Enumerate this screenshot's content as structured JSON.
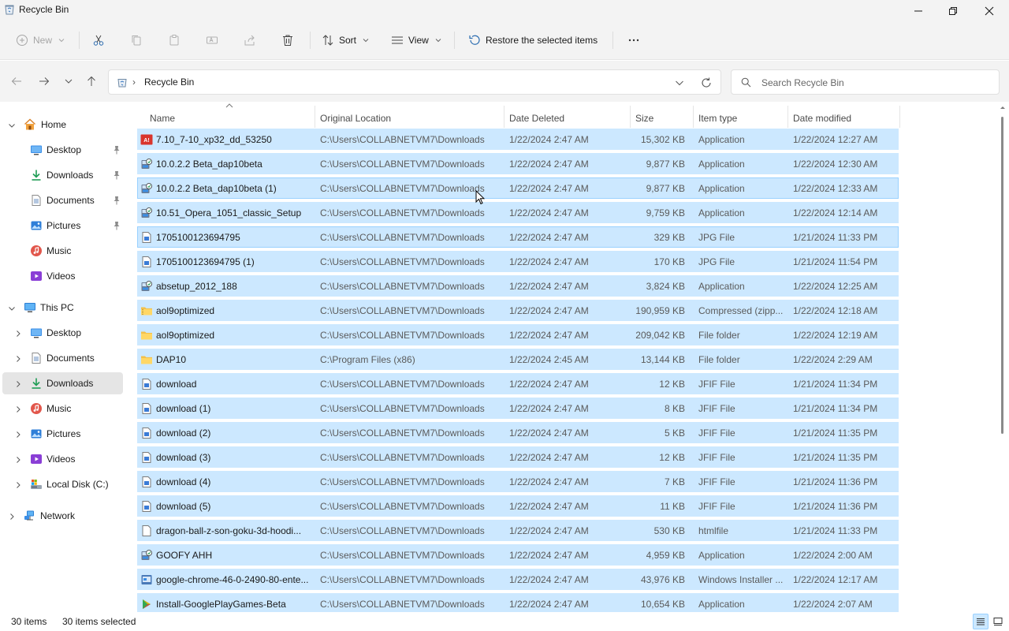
{
  "window": {
    "title": "Recycle Bin"
  },
  "commandbar": {
    "new_label": "New",
    "sort_label": "Sort",
    "view_label": "View",
    "restore_label": "Restore the selected items"
  },
  "address": {
    "crumb": "Recycle Bin",
    "search_placeholder": "Search Recycle Bin"
  },
  "sidebar": {
    "home": "Home",
    "quick": [
      {
        "label": "Desktop",
        "icon": "desktop-icon"
      },
      {
        "label": "Downloads",
        "icon": "download-icon"
      },
      {
        "label": "Documents",
        "icon": "document-icon"
      },
      {
        "label": "Pictures",
        "icon": "picture-icon"
      },
      {
        "label": "Music",
        "icon": "music-icon"
      },
      {
        "label": "Videos",
        "icon": "video-icon"
      }
    ],
    "this_pc": "This PC",
    "pc_items": [
      {
        "label": "Desktop",
        "icon": "desktop-icon"
      },
      {
        "label": "Documents",
        "icon": "document-icon"
      },
      {
        "label": "Downloads",
        "icon": "download-icon"
      },
      {
        "label": "Music",
        "icon": "music-icon"
      },
      {
        "label": "Pictures",
        "icon": "picture-icon"
      },
      {
        "label": "Videos",
        "icon": "video-icon"
      },
      {
        "label": "Local Disk (C:)",
        "icon": "drive-icon"
      }
    ],
    "network": "Network"
  },
  "columns": {
    "name": "Name",
    "location": "Original Location",
    "deleted": "Date Deleted",
    "size": "Size",
    "type": "Item type",
    "modified": "Date modified"
  },
  "files": [
    {
      "name": "7.10_7-10_xp32_dd_53250",
      "loc": "C:\\Users\\COLLABNETVM7\\Downloads",
      "deleted": "1/22/2024 2:47 AM",
      "size": "15,302 KB",
      "type": "Application",
      "modified": "1/22/2024 12:27 AM",
      "icon": "red-app-icon"
    },
    {
      "name": "10.0.2.2 Beta_dap10beta",
      "loc": "C:\\Users\\COLLABNETVM7\\Downloads",
      "deleted": "1/22/2024 2:47 AM",
      "size": "9,877 KB",
      "type": "Application",
      "modified": "1/22/2024 12:30 AM",
      "icon": "installer-icon"
    },
    {
      "name": "10.0.2.2 Beta_dap10beta (1)",
      "loc": "C:\\Users\\COLLABNETVM7\\Downloads",
      "deleted": "1/22/2024 2:47 AM",
      "size": "9,877 KB",
      "type": "Application",
      "modified": "1/22/2024 12:33 AM",
      "icon": "installer-icon"
    },
    {
      "name": "10.51_Opera_1051_classic_Setup",
      "loc": "C:\\Users\\COLLABNETVM7\\Downloads",
      "deleted": "1/22/2024 2:47 AM",
      "size": "9,759 KB",
      "type": "Application",
      "modified": "1/22/2024 12:14 AM",
      "icon": "installer-icon"
    },
    {
      "name": "1705100123694795",
      "loc": "C:\\Users\\COLLABNETVM7\\Downloads",
      "deleted": "1/22/2024 2:47 AM",
      "size": "329 KB",
      "type": "JPG File",
      "modified": "1/21/2024 11:33 PM",
      "icon": "image-file-icon"
    },
    {
      "name": "1705100123694795 (1)",
      "loc": "C:\\Users\\COLLABNETVM7\\Downloads",
      "deleted": "1/22/2024 2:47 AM",
      "size": "170 KB",
      "type": "JPG File",
      "modified": "1/21/2024 11:54 PM",
      "icon": "image-file-icon"
    },
    {
      "name": "absetup_2012_188",
      "loc": "C:\\Users\\COLLABNETVM7\\Downloads",
      "deleted": "1/22/2024 2:47 AM",
      "size": "3,824 KB",
      "type": "Application",
      "modified": "1/22/2024 12:25 AM",
      "icon": "installer-icon"
    },
    {
      "name": "aol9optimized",
      "loc": "C:\\Users\\COLLABNETVM7\\Downloads",
      "deleted": "1/22/2024 2:47 AM",
      "size": "190,959 KB",
      "type": "Compressed (zipp...",
      "modified": "1/22/2024 12:18 AM",
      "icon": "zip-folder-icon"
    },
    {
      "name": "aol9optimized",
      "loc": "C:\\Users\\COLLABNETVM7\\Downloads",
      "deleted": "1/22/2024 2:47 AM",
      "size": "209,042 KB",
      "type": "File folder",
      "modified": "1/22/2024 12:19 AM",
      "icon": "folder-icon"
    },
    {
      "name": "DAP10",
      "loc": "C:\\Program Files (x86)",
      "deleted": "1/22/2024 2:45 AM",
      "size": "13,144 KB",
      "type": "File folder",
      "modified": "1/22/2024 2:29 AM",
      "icon": "folder-icon"
    },
    {
      "name": "download",
      "loc": "C:\\Users\\COLLABNETVM7\\Downloads",
      "deleted": "1/22/2024 2:47 AM",
      "size": "12 KB",
      "type": "JFIF File",
      "modified": "1/21/2024 11:34 PM",
      "icon": "image-file-icon"
    },
    {
      "name": "download (1)",
      "loc": "C:\\Users\\COLLABNETVM7\\Downloads",
      "deleted": "1/22/2024 2:47 AM",
      "size": "8 KB",
      "type": "JFIF File",
      "modified": "1/21/2024 11:34 PM",
      "icon": "image-file-icon"
    },
    {
      "name": "download (2)",
      "loc": "C:\\Users\\COLLABNETVM7\\Downloads",
      "deleted": "1/22/2024 2:47 AM",
      "size": "5 KB",
      "type": "JFIF File",
      "modified": "1/21/2024 11:35 PM",
      "icon": "image-file-icon"
    },
    {
      "name": "download (3)",
      "loc": "C:\\Users\\COLLABNETVM7\\Downloads",
      "deleted": "1/22/2024 2:47 AM",
      "size": "12 KB",
      "type": "JFIF File",
      "modified": "1/21/2024 11:35 PM",
      "icon": "image-file-icon"
    },
    {
      "name": "download (4)",
      "loc": "C:\\Users\\COLLABNETVM7\\Downloads",
      "deleted": "1/22/2024 2:47 AM",
      "size": "7 KB",
      "type": "JFIF File",
      "modified": "1/21/2024 11:36 PM",
      "icon": "image-file-icon"
    },
    {
      "name": "download (5)",
      "loc": "C:\\Users\\COLLABNETVM7\\Downloads",
      "deleted": "1/22/2024 2:47 AM",
      "size": "11 KB",
      "type": "JFIF File",
      "modified": "1/21/2024 11:36 PM",
      "icon": "image-file-icon"
    },
    {
      "name": "dragon-ball-z-son-goku-3d-hoodi...",
      "loc": "C:\\Users\\COLLABNETVM7\\Downloads",
      "deleted": "1/22/2024 2:47 AM",
      "size": "530 KB",
      "type": "htmlfile",
      "modified": "1/21/2024 11:33 PM",
      "icon": "html-file-icon"
    },
    {
      "name": "GOOFY AHH",
      "loc": "C:\\Users\\COLLABNETVM7\\Downloads",
      "deleted": "1/22/2024 2:47 AM",
      "size": "4,959 KB",
      "type": "Application",
      "modified": "1/22/2024 2:00 AM",
      "icon": "installer-icon"
    },
    {
      "name": "google-chrome-46-0-2490-80-ente...",
      "loc": "C:\\Users\\COLLABNETVM7\\Downloads",
      "deleted": "1/22/2024 2:47 AM",
      "size": "43,976 KB",
      "type": "Windows Installer ...",
      "modified": "1/22/2024 12:17 AM",
      "icon": "msi-icon"
    },
    {
      "name": "Install-GooglePlayGames-Beta",
      "loc": "C:\\Users\\COLLABNETVM7\\Downloads",
      "deleted": "1/22/2024 2:47 AM",
      "size": "10,654 KB",
      "type": "Application",
      "modified": "1/22/2024 2:07 AM",
      "icon": "play-icon"
    }
  ],
  "status": {
    "count": "30 items",
    "selected": "30 items selected"
  },
  "colors": {
    "selection": "#cce8ff",
    "selection_border": "#99d1ff",
    "chrome": "#f3f3f3"
  }
}
